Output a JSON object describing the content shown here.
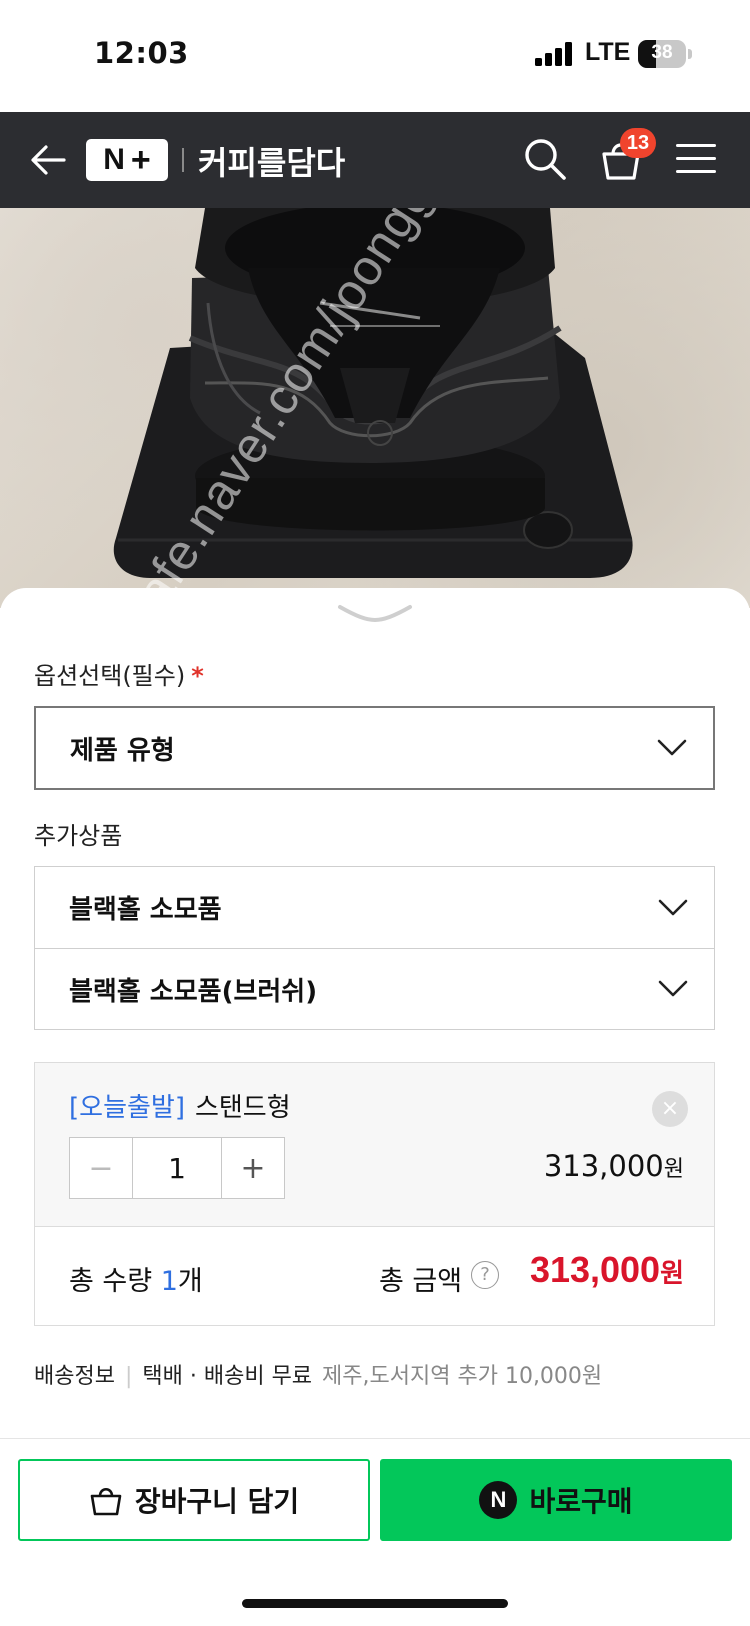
{
  "status_bar": {
    "time": "12:03",
    "network": "LTE",
    "battery": "38"
  },
  "nav": {
    "logo_n": "N",
    "logo_plus": "+",
    "store_name": "커피를담다",
    "cart_count": "13"
  },
  "watermark": "cafe.naver.com/joonggonara",
  "option": {
    "label": "옵션선택(필수)",
    "required_mark": "*",
    "select_value": "제품 유형"
  },
  "addon": {
    "label": "추가상품",
    "items": [
      {
        "label": "블랙홀 소모품"
      },
      {
        "label": "블랙홀 소모품(브러쉬)"
      }
    ]
  },
  "selected_item": {
    "tag": "[오늘출발]",
    "name": "스탠드형",
    "remove": "×",
    "minus": "−",
    "quantity": "1",
    "plus": "+",
    "price": "313,000",
    "price_unit": "원"
  },
  "total": {
    "qty_label": "총 수량",
    "qty_value": "1",
    "qty_unit": "개",
    "amount_label": "총 금액",
    "help": "?",
    "amount": "313,000",
    "amount_unit": "원"
  },
  "shipping": {
    "label": "배송정보",
    "method": "택배 · 배송비 무료",
    "extra": "제주,도서지역 추가 10,000원"
  },
  "actions": {
    "cart_label": "장바구니 담기",
    "buy_icon": "N",
    "buy_label": "바로구매"
  },
  "colors": {
    "accent_green": "#03c75a",
    "price_red": "#d9152b",
    "tag_blue": "#2f6fe0",
    "navbar": "#2c2d31",
    "badge": "#f0442d"
  }
}
